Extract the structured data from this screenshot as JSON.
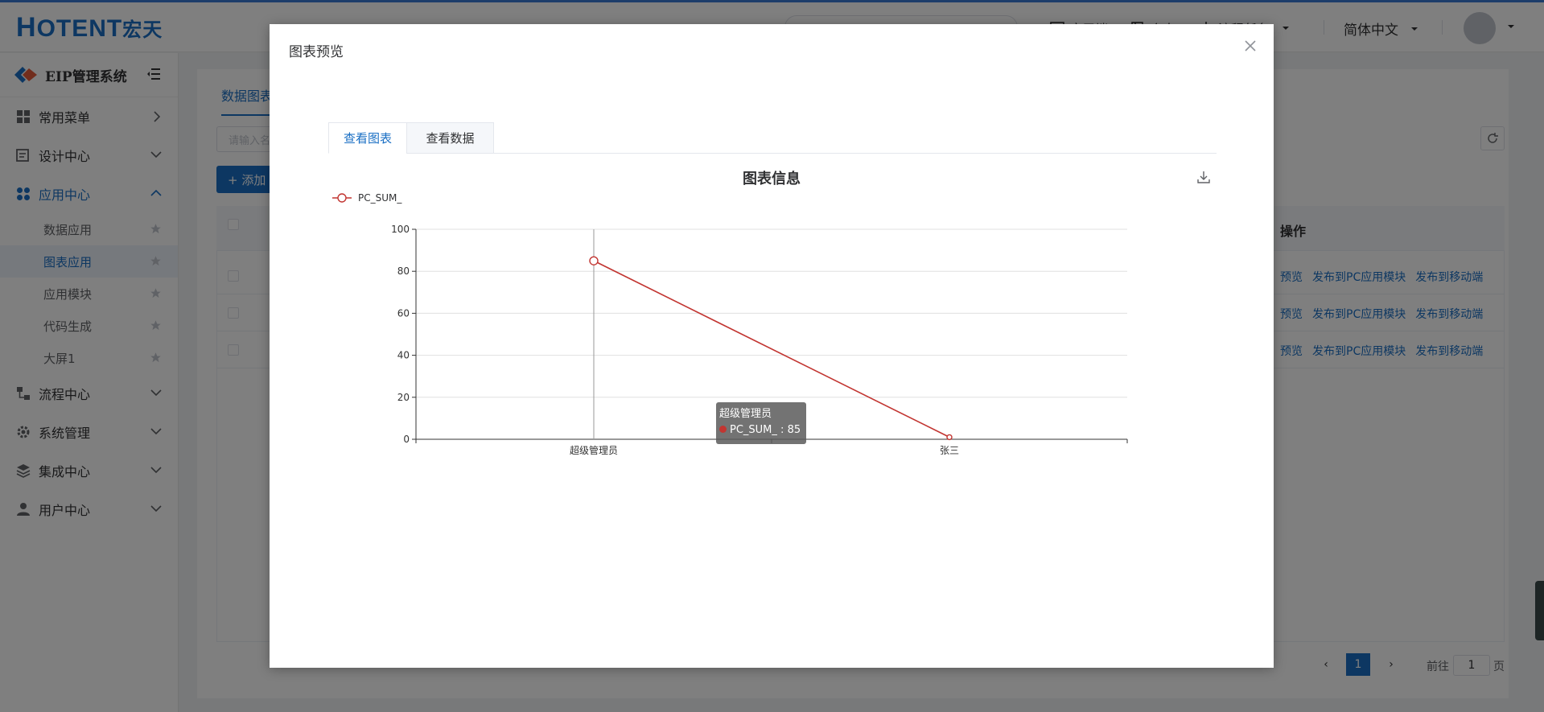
{
  "header": {
    "logo_main": "OTENT",
    "logo_h": "H",
    "logo_cn": "宏天",
    "tool_1": "应用端",
    "tool_2": "个人",
    "tool_3": "流程任务",
    "language": "简体中文"
  },
  "sidebar": {
    "brand": "EIP管理系统",
    "menu": [
      {
        "label": "常用菜单"
      },
      {
        "label": "设计中心"
      },
      {
        "label": "应用中心"
      },
      {
        "label": "流程中心"
      },
      {
        "label": "系统管理"
      },
      {
        "label": "集成中心"
      },
      {
        "label": "用户中心"
      }
    ],
    "sub_items": [
      {
        "label": "数据应用"
      },
      {
        "label": "图表应用"
      },
      {
        "label": "应用模块"
      },
      {
        "label": "代码生成"
      },
      {
        "label": "大屏1"
      }
    ]
  },
  "main": {
    "tab": "数据图表",
    "search_placeholder": "请输入名称",
    "add_button": "+ 添加",
    "ops_header": "操作",
    "row_links": [
      "预览",
      "发布到PC应用模块",
      "发布到移动端"
    ],
    "pager": {
      "page": "1",
      "goto_label": "前往",
      "page_unit": "页",
      "goto_value": "1"
    }
  },
  "modal": {
    "title": "图表预览",
    "tabs": [
      {
        "label": "查看图表"
      },
      {
        "label": "查看数据"
      }
    ],
    "tooltip": {
      "title": "超级管理员",
      "series": "PC_SUM_",
      "value": "85"
    }
  },
  "colors": {
    "accent": "#1a6fc4",
    "series": "#c23531"
  },
  "chart_data": {
    "type": "line",
    "title": "图表信息",
    "categories": [
      "超级管理员",
      "张三"
    ],
    "series": [
      {
        "name": "PC_SUM_",
        "values": [
          85,
          1
        ]
      }
    ],
    "ylim": [
      0,
      100
    ],
    "yticks": [
      0,
      20,
      40,
      60,
      80,
      100
    ],
    "grid": true,
    "legend": "top-left"
  }
}
